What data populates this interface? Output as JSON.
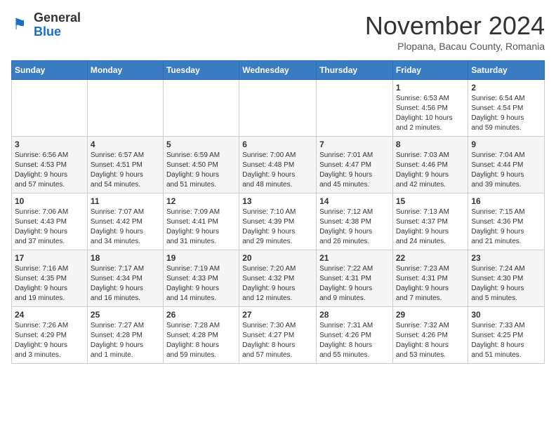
{
  "header": {
    "logo_general": "General",
    "logo_blue": "Blue",
    "month_title": "November 2024",
    "location": "Plopana, Bacau County, Romania"
  },
  "days_of_week": [
    "Sunday",
    "Monday",
    "Tuesday",
    "Wednesday",
    "Thursday",
    "Friday",
    "Saturday"
  ],
  "weeks": [
    [
      {
        "day": "",
        "info": ""
      },
      {
        "day": "",
        "info": ""
      },
      {
        "day": "",
        "info": ""
      },
      {
        "day": "",
        "info": ""
      },
      {
        "day": "",
        "info": ""
      },
      {
        "day": "1",
        "info": "Sunrise: 6:53 AM\nSunset: 4:56 PM\nDaylight: 10 hours\nand 2 minutes."
      },
      {
        "day": "2",
        "info": "Sunrise: 6:54 AM\nSunset: 4:54 PM\nDaylight: 9 hours\nand 59 minutes."
      }
    ],
    [
      {
        "day": "3",
        "info": "Sunrise: 6:56 AM\nSunset: 4:53 PM\nDaylight: 9 hours\nand 57 minutes."
      },
      {
        "day": "4",
        "info": "Sunrise: 6:57 AM\nSunset: 4:51 PM\nDaylight: 9 hours\nand 54 minutes."
      },
      {
        "day": "5",
        "info": "Sunrise: 6:59 AM\nSunset: 4:50 PM\nDaylight: 9 hours\nand 51 minutes."
      },
      {
        "day": "6",
        "info": "Sunrise: 7:00 AM\nSunset: 4:48 PM\nDaylight: 9 hours\nand 48 minutes."
      },
      {
        "day": "7",
        "info": "Sunrise: 7:01 AM\nSunset: 4:47 PM\nDaylight: 9 hours\nand 45 minutes."
      },
      {
        "day": "8",
        "info": "Sunrise: 7:03 AM\nSunset: 4:46 PM\nDaylight: 9 hours\nand 42 minutes."
      },
      {
        "day": "9",
        "info": "Sunrise: 7:04 AM\nSunset: 4:44 PM\nDaylight: 9 hours\nand 39 minutes."
      }
    ],
    [
      {
        "day": "10",
        "info": "Sunrise: 7:06 AM\nSunset: 4:43 PM\nDaylight: 9 hours\nand 37 minutes."
      },
      {
        "day": "11",
        "info": "Sunrise: 7:07 AM\nSunset: 4:42 PM\nDaylight: 9 hours\nand 34 minutes."
      },
      {
        "day": "12",
        "info": "Sunrise: 7:09 AM\nSunset: 4:41 PM\nDaylight: 9 hours\nand 31 minutes."
      },
      {
        "day": "13",
        "info": "Sunrise: 7:10 AM\nSunset: 4:39 PM\nDaylight: 9 hours\nand 29 minutes."
      },
      {
        "day": "14",
        "info": "Sunrise: 7:12 AM\nSunset: 4:38 PM\nDaylight: 9 hours\nand 26 minutes."
      },
      {
        "day": "15",
        "info": "Sunrise: 7:13 AM\nSunset: 4:37 PM\nDaylight: 9 hours\nand 24 minutes."
      },
      {
        "day": "16",
        "info": "Sunrise: 7:15 AM\nSunset: 4:36 PM\nDaylight: 9 hours\nand 21 minutes."
      }
    ],
    [
      {
        "day": "17",
        "info": "Sunrise: 7:16 AM\nSunset: 4:35 PM\nDaylight: 9 hours\nand 19 minutes."
      },
      {
        "day": "18",
        "info": "Sunrise: 7:17 AM\nSunset: 4:34 PM\nDaylight: 9 hours\nand 16 minutes."
      },
      {
        "day": "19",
        "info": "Sunrise: 7:19 AM\nSunset: 4:33 PM\nDaylight: 9 hours\nand 14 minutes."
      },
      {
        "day": "20",
        "info": "Sunrise: 7:20 AM\nSunset: 4:32 PM\nDaylight: 9 hours\nand 12 minutes."
      },
      {
        "day": "21",
        "info": "Sunrise: 7:22 AM\nSunset: 4:31 PM\nDaylight: 9 hours\nand 9 minutes."
      },
      {
        "day": "22",
        "info": "Sunrise: 7:23 AM\nSunset: 4:31 PM\nDaylight: 9 hours\nand 7 minutes."
      },
      {
        "day": "23",
        "info": "Sunrise: 7:24 AM\nSunset: 4:30 PM\nDaylight: 9 hours\nand 5 minutes."
      }
    ],
    [
      {
        "day": "24",
        "info": "Sunrise: 7:26 AM\nSunset: 4:29 PM\nDaylight: 9 hours\nand 3 minutes."
      },
      {
        "day": "25",
        "info": "Sunrise: 7:27 AM\nSunset: 4:28 PM\nDaylight: 9 hours\nand 1 minute."
      },
      {
        "day": "26",
        "info": "Sunrise: 7:28 AM\nSunset: 4:28 PM\nDaylight: 8 hours\nand 59 minutes."
      },
      {
        "day": "27",
        "info": "Sunrise: 7:30 AM\nSunset: 4:27 PM\nDaylight: 8 hours\nand 57 minutes."
      },
      {
        "day": "28",
        "info": "Sunrise: 7:31 AM\nSunset: 4:26 PM\nDaylight: 8 hours\nand 55 minutes."
      },
      {
        "day": "29",
        "info": "Sunrise: 7:32 AM\nSunset: 4:26 PM\nDaylight: 8 hours\nand 53 minutes."
      },
      {
        "day": "30",
        "info": "Sunrise: 7:33 AM\nSunset: 4:25 PM\nDaylight: 8 hours\nand 51 minutes."
      }
    ]
  ]
}
